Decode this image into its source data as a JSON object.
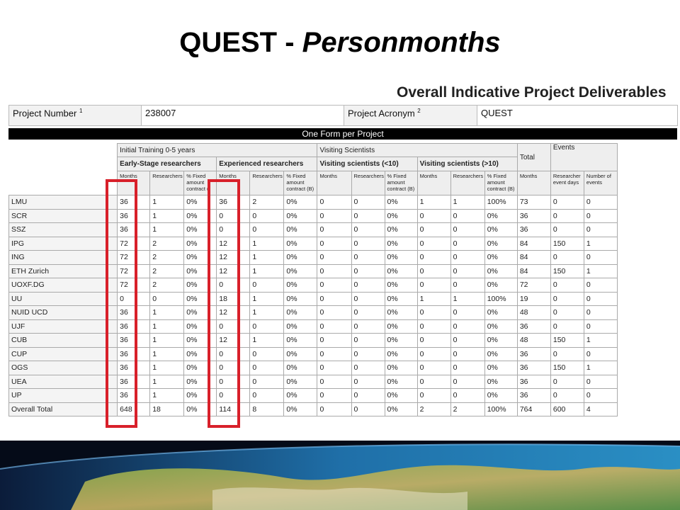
{
  "slide": {
    "title_main": "QUEST - ",
    "title_italic": "Personmonths"
  },
  "form": {
    "heading": "Overall Indicative Project Deliverables",
    "project_number_label": "Project Number",
    "project_number_sup": "1",
    "project_number_value": "238007",
    "project_acronym_label": "Project Acronym",
    "project_acronym_sup": "2",
    "project_acronym_value": "QUEST",
    "banner": "One Form per Project"
  },
  "table": {
    "group_headers": {
      "initial_training": "Initial Training 0-5 years",
      "visiting_scientists": "Visiting Scientists",
      "total": "Total",
      "events": "Events"
    },
    "sub_headers": {
      "early_stage": "Early-Stage researchers",
      "experienced": "Experienced researchers",
      "visiting_lt10": "Visiting scientists (<10)",
      "visiting_gt10": "Visiting scientists (>10)"
    },
    "columns": [
      "Months",
      "Researchers",
      "% Fixed amount contract (",
      "Months",
      "Researchers",
      "% Fixed amount contract (B)",
      "Months",
      "Researchers",
      "% Fixed amount contract (B)",
      "Months",
      "Researchers",
      "% Fixed amount contract (B)",
      "Months",
      "Researcher event days",
      "Number of events"
    ],
    "rows": [
      [
        "LMU",
        "36",
        "1",
        "0%",
        "36",
        "2",
        "0%",
        "0",
        "0",
        "0%",
        "1",
        "1",
        "100%",
        "73",
        "0",
        "0"
      ],
      [
        "SCR",
        "36",
        "1",
        "0%",
        "0",
        "0",
        "0%",
        "0",
        "0",
        "0%",
        "0",
        "0",
        "0%",
        "36",
        "0",
        "0"
      ],
      [
        "SSZ",
        "36",
        "1",
        "0%",
        "0",
        "0",
        "0%",
        "0",
        "0",
        "0%",
        "0",
        "0",
        "0%",
        "36",
        "0",
        "0"
      ],
      [
        "IPG",
        "72",
        "2",
        "0%",
        "12",
        "1",
        "0%",
        "0",
        "0",
        "0%",
        "0",
        "0",
        "0%",
        "84",
        "150",
        "1"
      ],
      [
        "ING",
        "72",
        "2",
        "0%",
        "12",
        "1",
        "0%",
        "0",
        "0",
        "0%",
        "0",
        "0",
        "0%",
        "84",
        "0",
        "0"
      ],
      [
        "ETH Zurich",
        "72",
        "2",
        "0%",
        "12",
        "1",
        "0%",
        "0",
        "0",
        "0%",
        "0",
        "0",
        "0%",
        "84",
        "150",
        "1"
      ],
      [
        "UOXF.DG",
        "72",
        "2",
        "0%",
        "0",
        "0",
        "0%",
        "0",
        "0",
        "0%",
        "0",
        "0",
        "0%",
        "72",
        "0",
        "0"
      ],
      [
        "UU",
        "0",
        "0",
        "0%",
        "18",
        "1",
        "0%",
        "0",
        "0",
        "0%",
        "1",
        "1",
        "100%",
        "19",
        "0",
        "0"
      ],
      [
        "NUID UCD",
        "36",
        "1",
        "0%",
        "12",
        "1",
        "0%",
        "0",
        "0",
        "0%",
        "0",
        "0",
        "0%",
        "48",
        "0",
        "0"
      ],
      [
        "UJF",
        "36",
        "1",
        "0%",
        "0",
        "0",
        "0%",
        "0",
        "0",
        "0%",
        "0",
        "0",
        "0%",
        "36",
        "0",
        "0"
      ],
      [
        "CUB",
        "36",
        "1",
        "0%",
        "12",
        "1",
        "0%",
        "0",
        "0",
        "0%",
        "0",
        "0",
        "0%",
        "48",
        "150",
        "1"
      ],
      [
        "CUP",
        "36",
        "1",
        "0%",
        "0",
        "0",
        "0%",
        "0",
        "0",
        "0%",
        "0",
        "0",
        "0%",
        "36",
        "0",
        "0"
      ],
      [
        "OGS",
        "36",
        "1",
        "0%",
        "0",
        "0",
        "0%",
        "0",
        "0",
        "0%",
        "0",
        "0",
        "0%",
        "36",
        "150",
        "1"
      ],
      [
        "UEA",
        "36",
        "1",
        "0%",
        "0",
        "0",
        "0%",
        "0",
        "0",
        "0%",
        "0",
        "0",
        "0%",
        "36",
        "0",
        "0"
      ],
      [
        "UP",
        "36",
        "1",
        "0%",
        "0",
        "0",
        "0%",
        "0",
        "0",
        "0%",
        "0",
        "0",
        "0%",
        "36",
        "0",
        "0"
      ],
      [
        "Overall Total",
        "648",
        "18",
        "0%",
        "114",
        "8",
        "0%",
        "0",
        "0",
        "0%",
        "2",
        "2",
        "100%",
        "764",
        "600",
        "4"
      ]
    ]
  },
  "colors": {
    "highlight": "#d8202a",
    "banner_bg": "#000000"
  }
}
